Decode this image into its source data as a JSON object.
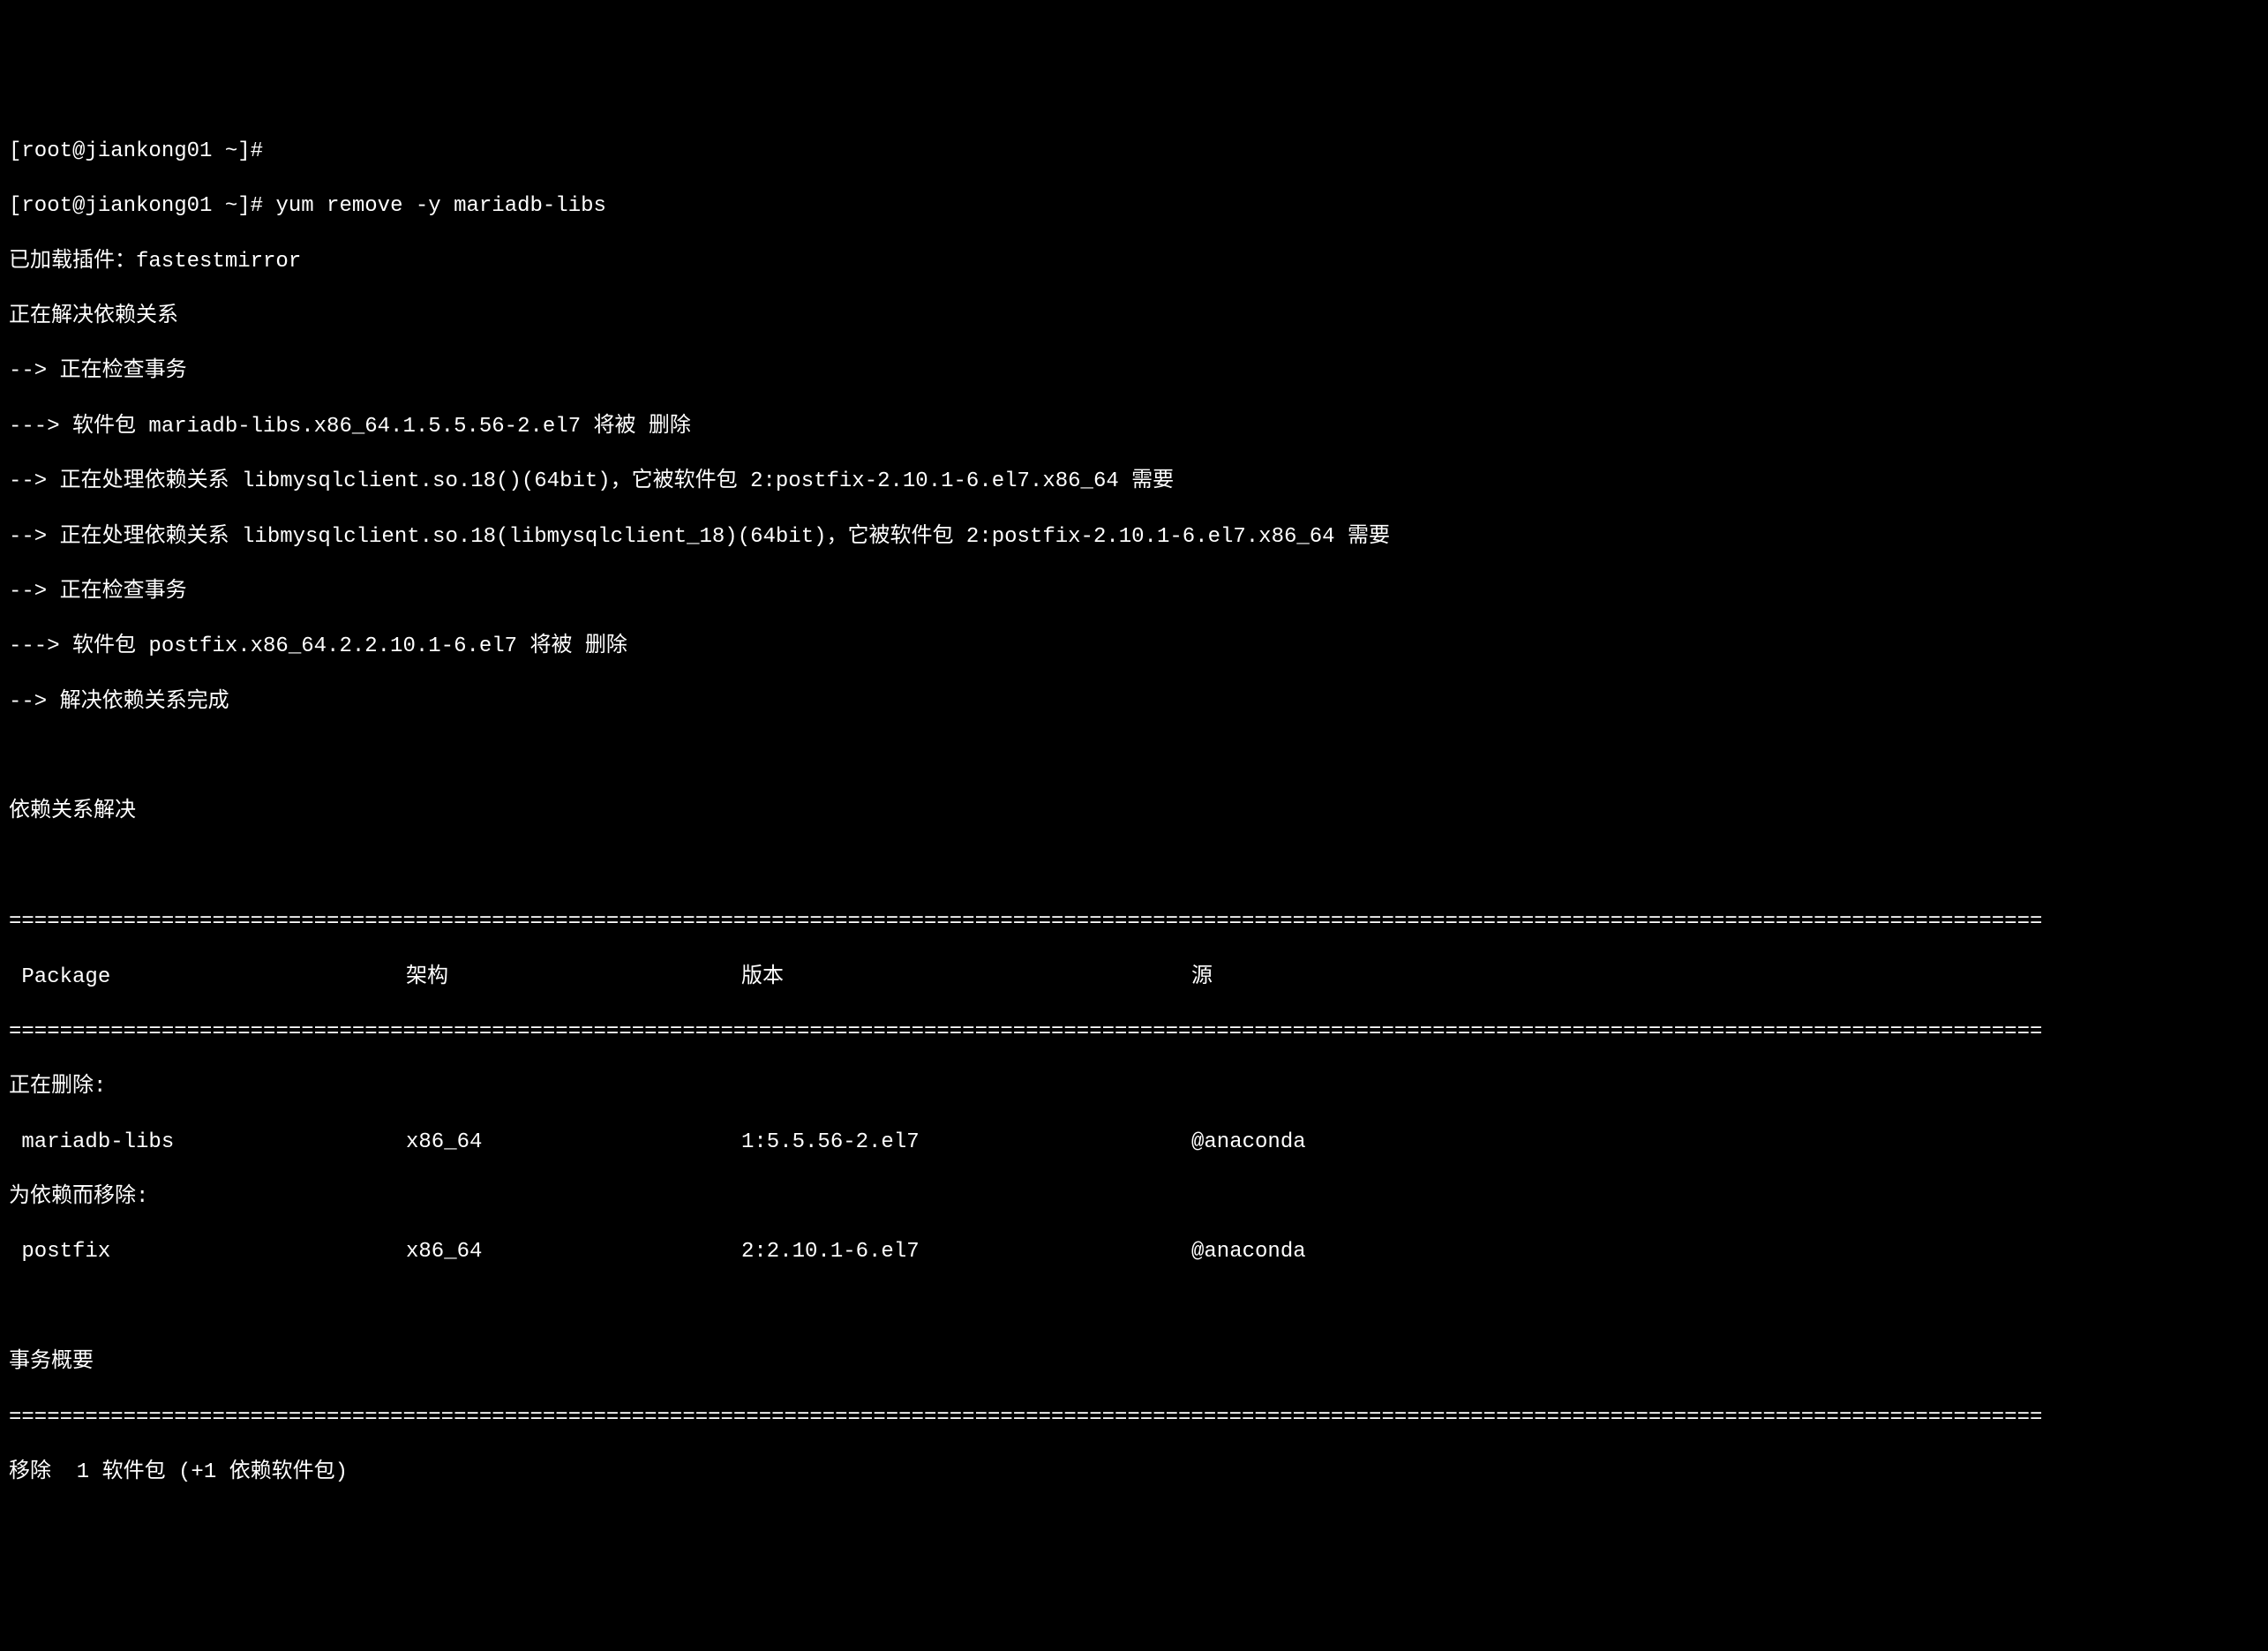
{
  "terminal": {
    "prompt1": "[root@jiankong01 ~]#",
    "prompt2": "[root@jiankong01 ~]# yum remove -y mariadb-libs",
    "loaded_plugins": "已加载插件：fastestmirror",
    "resolving_deps": "正在解决依赖关系",
    "checking_trans1": "--> 正在检查事务",
    "pkg_remove1": "---> 软件包 mariadb-libs.x86_64.1.5.5.56-2.el7 将被 删除",
    "processing_dep1": "--> 正在处理依赖关系 libmysqlclient.so.18()(64bit)，它被软件包 2:postfix-2.10.1-6.el7.x86_64 需要",
    "processing_dep2": "--> 正在处理依赖关系 libmysqlclient.so.18(libmysqlclient_18)(64bit)，它被软件包 2:postfix-2.10.1-6.el7.x86_64 需要",
    "checking_trans2": "--> 正在检查事务",
    "pkg_remove2": "---> 软件包 postfix.x86_64.2.2.10.1-6.el7 将被 删除",
    "finished_deps": "--> 解决依赖关系完成",
    "deps_resolved": "依赖关系解决",
    "table": {
      "headers": {
        "package": " Package",
        "arch": "架构",
        "version": "版本",
        "source": "源"
      },
      "section_removing": "正在删除:",
      "section_deps": "为依赖而移除:",
      "rows": [
        {
          "package": " mariadb-libs",
          "arch": "x86_64",
          "version": "1:5.5.56-2.el7",
          "source": "@anaconda"
        },
        {
          "package": " postfix",
          "arch": "x86_64",
          "version": "2:2.10.1-6.el7",
          "source": "@anaconda"
        }
      ]
    },
    "trans_summary": "事务概要",
    "remove_summary": "移除  1 软件包 (+1 依赖软件包)",
    "divider_double": "================================================================================================================================================================",
    "divider_single": "================================================================================================================================================================"
  }
}
